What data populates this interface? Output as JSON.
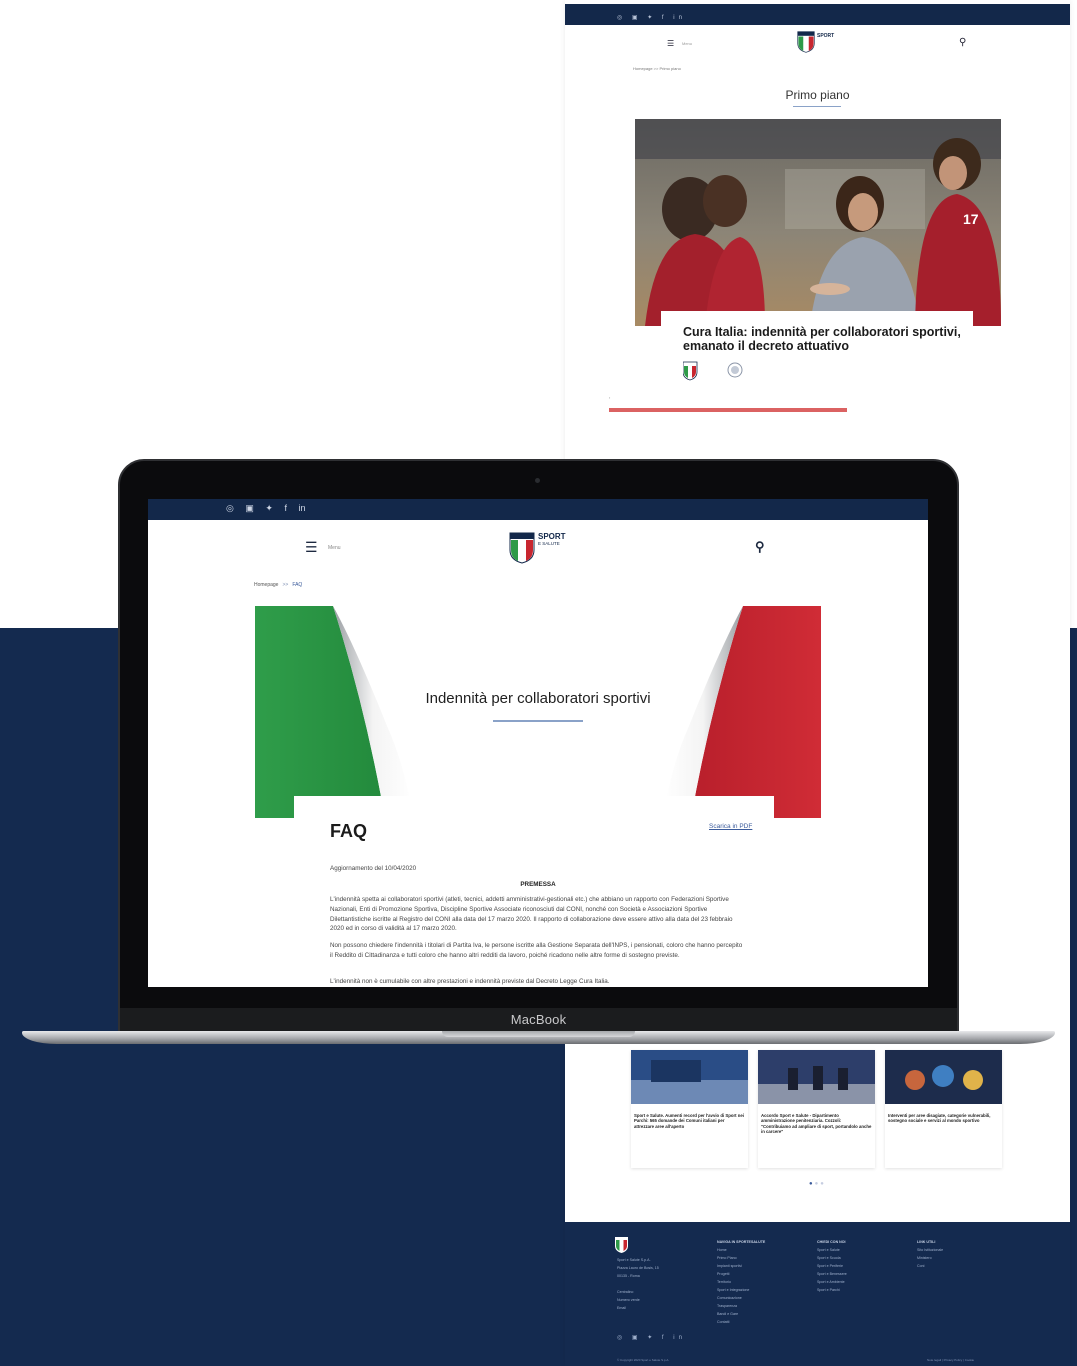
{
  "back_page": {
    "social_icons": [
      "instagram-icon",
      "youtube-icon",
      "twitter-icon",
      "facebook-icon",
      "linkedin-icon"
    ],
    "menu_label": "Menu",
    "logo_text": "SPORT",
    "breadcrumb": "Homepage  >>  Primo piano",
    "section_title": "Primo piano",
    "article_title": "Cura Italia: indennità per collaboratori sportivi, emanato il decreto attuativo",
    "news_cards": [
      {
        "title": "Sport e Salute. Aumenti record per l'avvio di Sport nei Parchi: 565 domande dei Comuni italiani per attrezzare aree all'aperto"
      },
      {
        "title": "Accordo Sport e Salute - Dipartimento amministrazione penitenziaria. Cozzoli: \"Contribuiamo ad ampliare di sport, portandolo anche in carcere\""
      },
      {
        "title": "Interventi per aree disagiate, categorie vulnerabili, sostegno sociale e servizi al mondo sportivo"
      }
    ],
    "footer_columns": [
      {
        "heading": "SPORT E SALUTE",
        "items": [
          "Sport e Salute S.p.A.",
          "Piazza Lauro de Bosis, 15",
          "00135 - Roma",
          "",
          "Centralino",
          "Numero verde",
          "Email"
        ]
      },
      {
        "heading": "NAVIGA IN SPORTESALUTE",
        "items": [
          "Home",
          "Primo Piano",
          "Impianti sportivi",
          "Progetti",
          "Territorio",
          "Sport e Integrazione",
          "Comunicazione",
          "Trasparenza",
          "Bandi e Gare",
          "Contatti"
        ]
      },
      {
        "heading": "CHIEDI CON NOI",
        "items": [
          "Sport e Salute",
          "Sport e Scuola",
          "Sport e Periferie",
          "Sport e Benessere",
          "Sport e Ambiente",
          "Sport e Parchi"
        ]
      },
      {
        "heading": "LINK UTILI",
        "items": [
          "Sito Istituzionale",
          "Ministero",
          "Coni"
        ]
      }
    ],
    "copyright": "© Copyright 2020 Sport e Salute S.p.A.",
    "footer_links": "Note legali  |  Privacy Policy  |  Cookie"
  },
  "laptop": {
    "brand": "MacBook",
    "screen": {
      "social_icons": [
        "instagram-icon",
        "youtube-icon",
        "twitter-icon",
        "facebook-icon",
        "linkedin-icon"
      ],
      "social_glyphs": [
        "◎",
        "▣",
        "✦",
        "f",
        "in"
      ],
      "menu_label": "Menu",
      "logo_line1": "SPORT",
      "logo_line2": "E SALUTE",
      "breadcrumb": {
        "home": "Homepage",
        "separator": ">>",
        "current": "FAQ"
      },
      "hero_title": "Indennità per collaboratori sportivi",
      "faq_title": "FAQ",
      "download_link": "Scarica in PDF",
      "updated": "Aggiornamento del 10/04/2020",
      "premessa": "PREMESSA",
      "paragraphs": [
        "L'indennità spetta ai collaboratori sportivi (atleti, tecnici, addetti amministrativi-gestionali etc.) che abbiano un rapporto con Federazioni Sportive Nazionali, Enti di Promozione Sportiva, Discipline Sportive Associate riconosciuti dal CONI, nonché con Società e Associazioni Sportive Dilettantistiche iscritte al Registro del CONI alla data del 17 marzo 2020. Il rapporto di collaborazione deve essere attivo alla data del 23 febbraio 2020 ed in corso di validità al 17 marzo 2020.",
        "Non possono chiedere l'indennità i titolari di Partita Iva, le persone iscritte alla Gestione Separata dell'INPS, i pensionati, coloro che hanno percepito il Reddito di Cittadinanza e tutti coloro che hanno altri redditi da lavoro, poiché ricadono nelle altre forme di sostegno previste.",
        "L'indennità non è cumulabile con altre prestazioni e indennità previste dal Decreto Legge Cura Italia."
      ]
    }
  },
  "colors": {
    "navy": "#142a4f",
    "accent_blue": "#3b5b9b",
    "flag_green": "#2e9a48",
    "flag_red": "#c8262f"
  }
}
